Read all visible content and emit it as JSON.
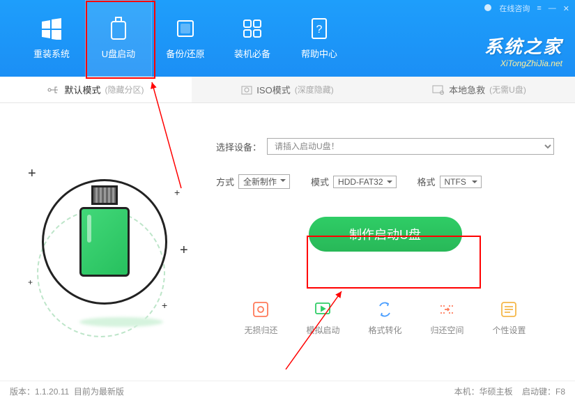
{
  "titlebar": {
    "consult": "在线咨询"
  },
  "nav": {
    "items": [
      {
        "label": "重装系统"
      },
      {
        "label": "U盘启动"
      },
      {
        "label": "备份/还原"
      },
      {
        "label": "装机必备"
      },
      {
        "label": "帮助中心"
      }
    ]
  },
  "brand": {
    "cn": "系统之家",
    "en": "XiTongZhiJia.net"
  },
  "tabs": {
    "items": [
      {
        "label": "默认模式",
        "sub": "(隐藏分区)"
      },
      {
        "label": "ISO模式",
        "sub": "(深度隐藏)"
      },
      {
        "label": "本地急救",
        "sub": "(无需U盘)"
      }
    ]
  },
  "form": {
    "device_label": "选择设备：",
    "device_placeholder": "请插入启动U盘！",
    "method_label": "方式",
    "method_value": "全新制作",
    "mode_label": "模式",
    "mode_value": "HDD-FAT32",
    "format_label": "格式",
    "format_value": "NTFS",
    "make_button": "制作启动U盘"
  },
  "bottom": {
    "items": [
      {
        "label": "无损归还"
      },
      {
        "label": "模拟启动"
      },
      {
        "label": "格式转化"
      },
      {
        "label": "归还空间"
      },
      {
        "label": "个性设置"
      }
    ]
  },
  "footer": {
    "version_prefix": "版本：",
    "version": "1.1.20.11",
    "version_status": "目前为最新版",
    "host_prefix": "本机：",
    "host": "华硕主板",
    "bootkey_prefix": "启动键：",
    "bootkey": "F8"
  }
}
